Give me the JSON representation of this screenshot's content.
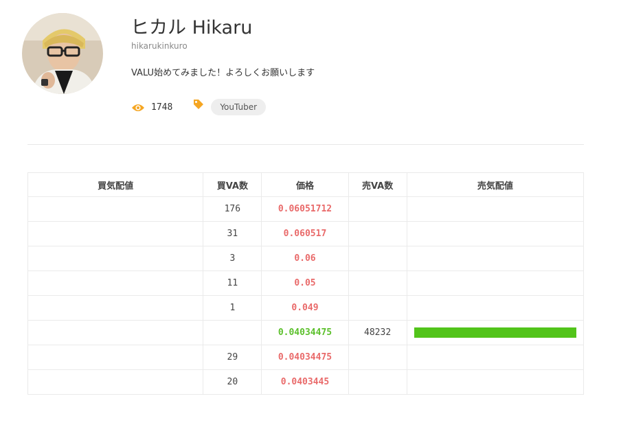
{
  "profile": {
    "name": "ヒカル Hikaru",
    "handle": "hikarukinkuro",
    "bio": "VALU始めてみました！よろしくお願いします",
    "view_count": "1748",
    "tag": "YouTuber"
  },
  "colors": {
    "accent_orange": "#f5a623",
    "buy_price": "#e96a6a",
    "sell_price": "#5cc02c",
    "bar_green": "#52c41a"
  },
  "icons": {
    "views": "eye-icon",
    "tag": "tag-icon"
  },
  "order_book": {
    "headers": [
      "買気配値",
      "買VA数",
      "価格",
      "売VA数",
      "売気配値"
    ],
    "rows": [
      {
        "buy_amount": "",
        "buy_count": "176",
        "price": "0.06051712",
        "side": "buy",
        "sell_count": "",
        "sell_amount": ""
      },
      {
        "buy_amount": "",
        "buy_count": "31",
        "price": "0.060517",
        "side": "buy",
        "sell_count": "",
        "sell_amount": ""
      },
      {
        "buy_amount": "",
        "buy_count": "3",
        "price": "0.06",
        "side": "buy",
        "sell_count": "",
        "sell_amount": ""
      },
      {
        "buy_amount": "",
        "buy_count": "11",
        "price": "0.05",
        "side": "buy",
        "sell_count": "",
        "sell_amount": ""
      },
      {
        "buy_amount": "",
        "buy_count": "1",
        "price": "0.049",
        "side": "buy",
        "sell_count": "",
        "sell_amount": ""
      },
      {
        "buy_amount": "",
        "buy_count": "",
        "price": "0.04034475",
        "side": "sell",
        "sell_count": "48232",
        "sell_amount": "",
        "sell_bar_fraction": 1.0
      },
      {
        "buy_amount": "",
        "buy_count": "29",
        "price": "0.04034475",
        "side": "buy",
        "sell_count": "",
        "sell_amount": ""
      },
      {
        "buy_amount": "",
        "buy_count": "20",
        "price": "0.0403445",
        "side": "buy",
        "sell_count": "",
        "sell_amount": ""
      }
    ]
  }
}
